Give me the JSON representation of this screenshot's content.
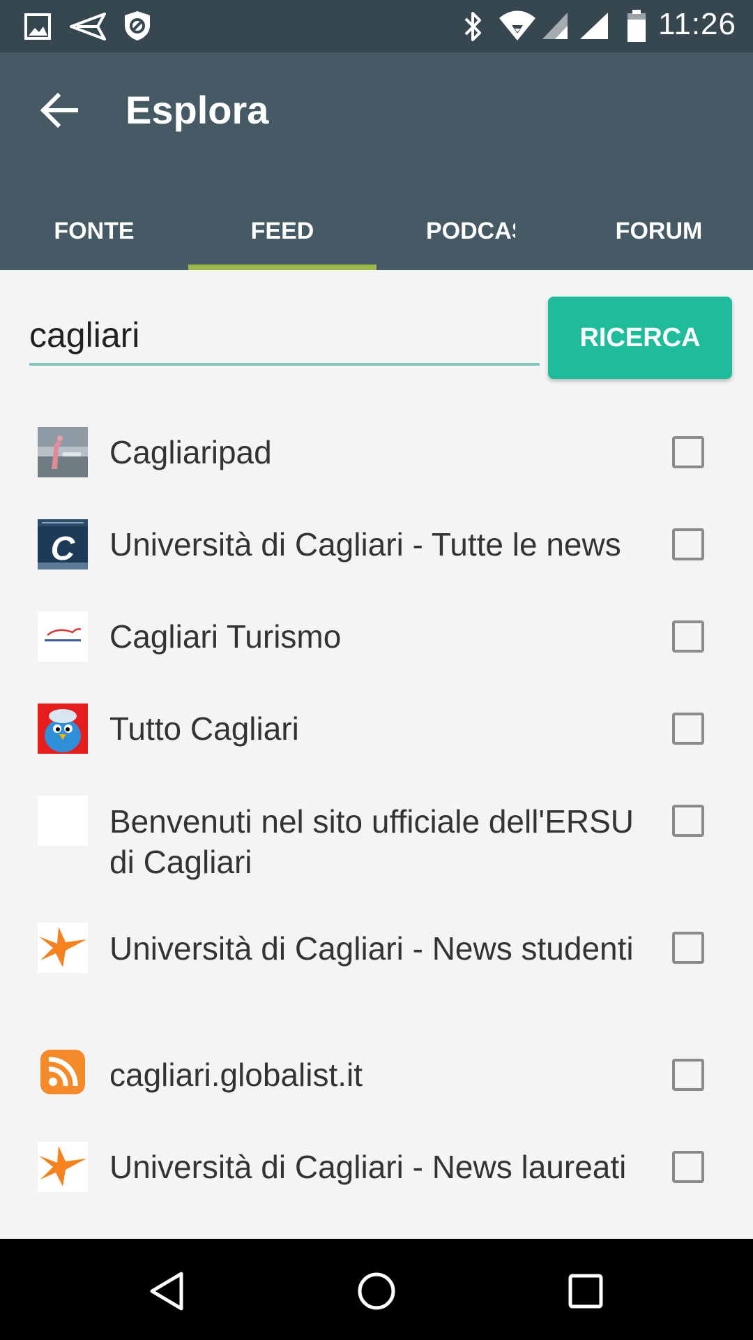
{
  "status_bar": {
    "time": "11:26",
    "left_icons": [
      "image-icon",
      "send-icon",
      "shield-icon"
    ],
    "right_icons": [
      "bluetooth-icon",
      "wifi-icon",
      "signal-icon",
      "signal-icon",
      "battery-icon"
    ]
  },
  "app_bar": {
    "title": "Esplora",
    "tabs": [
      {
        "label": "FONTE",
        "active": false
      },
      {
        "label": "FEED",
        "active": true
      },
      {
        "label": "PODCAST",
        "active": false
      },
      {
        "label": "FORUM",
        "active": false
      }
    ]
  },
  "search": {
    "value": "cagliari",
    "button_label": "RICERCA"
  },
  "results": [
    {
      "title": "Cagliaripad",
      "icon": "cagliaripad-thumbnail",
      "checked": false
    },
    {
      "title": "Università di Cagliari - Tutte le news",
      "icon": "unica-logo-icon",
      "checked": false
    },
    {
      "title": "Cagliari Turismo",
      "icon": "cagliari-turismo-logo-icon",
      "checked": false
    },
    {
      "title": "Tutto Cagliari",
      "icon": "bird-mascot-icon",
      "checked": false
    },
    {
      "title": "Benvenuti nel sito ufficiale dell'ERSU di Cagliari",
      "icon": "blank-thumbnail",
      "checked": false
    },
    {
      "title": "Università di Cagliari - News studenti",
      "icon": "orange-bird-icon",
      "checked": false
    },
    {
      "title": "cagliari.globalist.it",
      "icon": "rss-icon",
      "checked": false
    },
    {
      "title": "Università di Cagliari - News laureati",
      "icon": "orange-bird-icon",
      "checked": false
    }
  ],
  "colors": {
    "status_bar": "#37474f",
    "app_bar": "#455a64",
    "tab_indicator": "#9cb84a",
    "accent": "#1fbc9c",
    "input_underline": "#7cc8bd"
  },
  "nav_bar": {
    "buttons": [
      "back-icon",
      "home-icon",
      "recents-icon"
    ]
  }
}
